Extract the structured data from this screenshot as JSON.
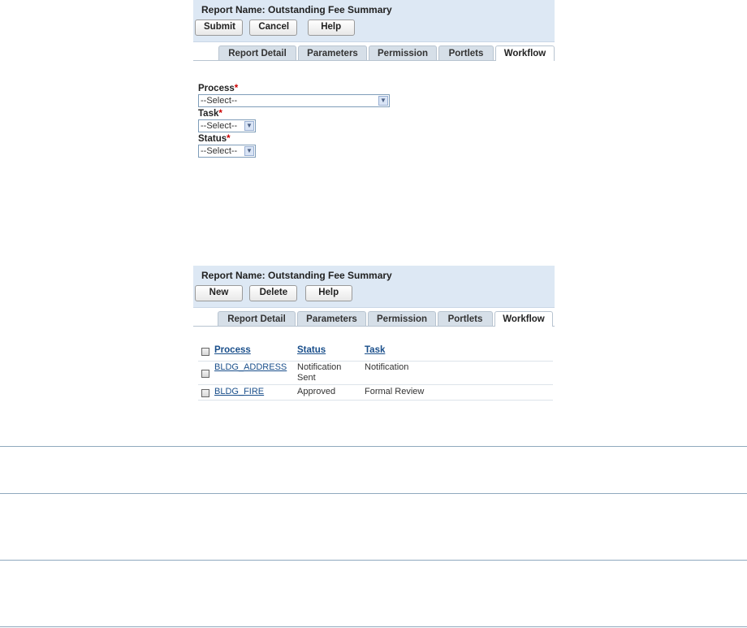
{
  "screen1": {
    "title": "Report Name: Outstanding Fee Summary",
    "buttons": [
      "Submit",
      "Cancel",
      "Help"
    ],
    "tabs": [
      "Report Detail",
      "Parameters",
      "Permission",
      "Portlets",
      "Workflow"
    ],
    "active_tab": "Workflow",
    "form": {
      "process_label": "Process",
      "process_value": "--Select--",
      "task_label": "Task",
      "task_value": "--Select--",
      "status_label": "Status",
      "status_value": "--Select--",
      "required_mark": "*"
    }
  },
  "screen2": {
    "title": "Report Name: Outstanding Fee Summary",
    "buttons": [
      "New",
      "Delete",
      "Help"
    ],
    "tabs": [
      "Report Detail",
      "Parameters",
      "Permission",
      "Portlets",
      "Workflow"
    ],
    "active_tab": "Workflow",
    "table": {
      "columns": [
        "Process",
        "Status",
        "Task"
      ],
      "rows": [
        {
          "process": "BLDG_ADDRESS",
          "status_line1": "Notification",
          "status_line2": "Sent",
          "task": "Notification"
        },
        {
          "process": "BLDG_FIRE",
          "status_line1": "Approved",
          "status_line2": "",
          "task": "Formal Review"
        }
      ]
    }
  }
}
